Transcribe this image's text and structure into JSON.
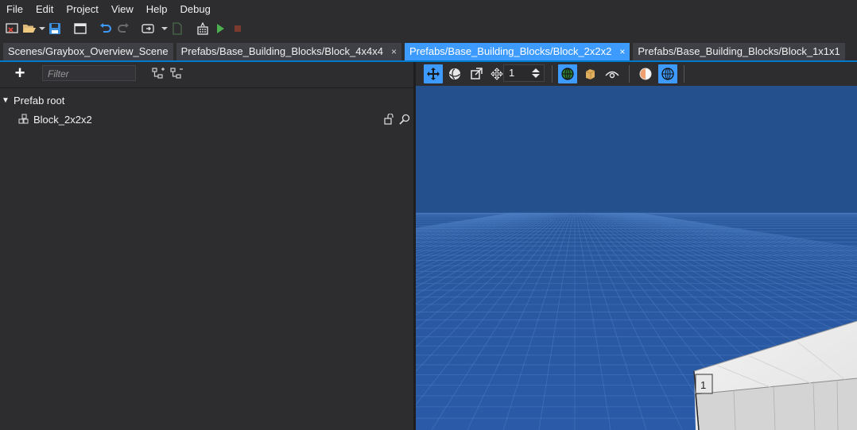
{
  "menu": [
    "File",
    "Edit",
    "Project",
    "View",
    "Help",
    "Debug"
  ],
  "tabs": [
    {
      "label": "Scenes/Graybox_Overview_Scene",
      "active": false,
      "closable": false
    },
    {
      "label": "Prefabs/Base_Building_Blocks/Block_4x4x4",
      "active": false,
      "closable": true
    },
    {
      "label": "Prefabs/Base_Building_Blocks/Block_2x2x2",
      "active": true,
      "closable": true
    },
    {
      "label": "Prefabs/Base_Building_Blocks/Block_1x1x1",
      "active": false,
      "closable": false
    }
  ],
  "close_glyph": "×",
  "left_panel": {
    "add_label": "+",
    "filter_placeholder": "Filter",
    "tree": {
      "root_label": "Prefab root",
      "caret": "▼",
      "children": [
        {
          "label": "Block_2x2x2",
          "icon": "block-node-icon"
        }
      ]
    }
  },
  "viewport_toolbar": {
    "grid_step_value": "1",
    "buttons": [
      {
        "name": "move-tool-icon",
        "active": true
      },
      {
        "name": "rotate-tool-icon",
        "active": false
      },
      {
        "name": "scale-tool-icon",
        "active": false
      },
      {
        "name": "pivot-move-icon",
        "active": false
      },
      {
        "name": "world-grid-icon",
        "active": true
      },
      {
        "name": "solid-shading-icon",
        "active": false
      },
      {
        "name": "visibility-eye-icon",
        "active": false
      },
      {
        "name": "lighting-sphere-icon",
        "active": false
      },
      {
        "name": "environment-globe-icon",
        "active": true
      }
    ]
  },
  "viewport": {
    "block_label": "1",
    "sky_color": "#254f8c",
    "floor_color": "#2658a0",
    "grid_color": "#4f7fc6"
  },
  "colors": {
    "accent": "#3d9bff",
    "background": "#2d2d30"
  }
}
